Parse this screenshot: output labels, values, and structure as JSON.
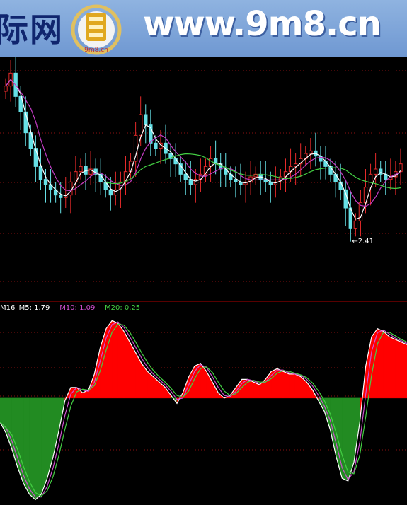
{
  "banner": {
    "left_text": "际网",
    "logo_text": "9m8.cn",
    "url_text": "www.9m8.cn"
  },
  "chart_data": [
    {
      "type": "candlestick",
      "panel": "price",
      "title": "",
      "ylim": [
        2.2,
        3.1
      ],
      "low_marker": {
        "label": "←2.41",
        "value": 2.41
      },
      "colors": {
        "up": "#e62a2a",
        "down": "#66e0e6",
        "ma_fast": "#ffffff",
        "ma_mid": "#c43cc4",
        "ma_slow": "#44d044"
      },
      "candles_close_path": [
        3.0,
        3.05,
        2.96,
        2.9,
        2.82,
        2.76,
        2.69,
        2.64,
        2.62,
        2.6,
        2.58,
        2.57,
        2.58,
        2.63,
        2.67,
        2.69,
        2.66,
        2.68,
        2.66,
        2.63,
        2.6,
        2.58,
        2.6,
        2.63,
        2.67,
        2.71,
        2.81,
        2.89,
        2.85,
        2.78,
        2.76,
        2.78,
        2.74,
        2.72,
        2.7,
        2.66,
        2.64,
        2.62,
        2.64,
        2.66,
        2.69,
        2.72,
        2.7,
        2.68,
        2.66,
        2.64,
        2.63,
        2.62,
        2.63,
        2.65,
        2.66,
        2.64,
        2.63,
        2.62,
        2.63,
        2.65,
        2.67,
        2.69,
        2.7,
        2.72,
        2.74,
        2.75,
        2.73,
        2.71,
        2.69,
        2.66,
        2.63,
        2.6,
        2.53,
        2.45,
        2.48,
        2.55,
        2.61,
        2.66,
        2.68,
        2.66,
        2.64,
        2.65,
        2.67,
        2.7
      ]
    },
    {
      "type": "area",
      "panel": "oscillator",
      "title": "",
      "legend": [
        {
          "label": "M16",
          "color": "#ffffff"
        },
        {
          "label": "M5: 1.79",
          "color": "#ffffff"
        },
        {
          "label": "M10: 1.09",
          "color": "#d050d0"
        },
        {
          "label": "M20: 0.25",
          "color": "#44d044"
        }
      ],
      "zero_line": 0,
      "ylim": [
        -4.0,
        3.2
      ],
      "colors": {
        "positive": "#ff0000",
        "negative": "#228b22"
      },
      "values": [
        -0.9,
        -1.3,
        -1.9,
        -2.6,
        -3.2,
        -3.6,
        -3.8,
        -3.6,
        -3.0,
        -2.2,
        -1.2,
        -0.1,
        0.4,
        0.4,
        0.2,
        0.3,
        0.9,
        1.9,
        2.6,
        2.9,
        2.8,
        2.5,
        2.1,
        1.7,
        1.3,
        1.0,
        0.8,
        0.6,
        0.4,
        0.1,
        -0.2,
        0.2,
        0.8,
        1.2,
        1.3,
        1.0,
        0.6,
        0.2,
        0.0,
        0.1,
        0.4,
        0.7,
        0.7,
        0.6,
        0.5,
        0.7,
        1.0,
        1.1,
        1.0,
        0.9,
        0.9,
        0.8,
        0.6,
        0.3,
        -0.1,
        -0.5,
        -1.2,
        -2.2,
        -3.0,
        -3.1,
        -2.4,
        -0.9,
        1.2,
        2.3,
        2.6,
        2.5,
        2.3,
        2.2,
        2.1,
        2.0
      ]
    }
  ]
}
